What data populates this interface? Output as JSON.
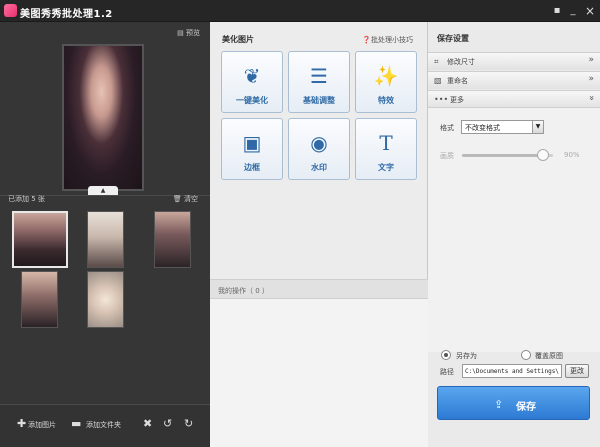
{
  "window": {
    "title": "美图秀秀批处理1.2",
    "minimize": "_",
    "close": "×",
    "menu": "▪"
  },
  "left": {
    "preview_label": "预览",
    "added_label": "已添加 5 张",
    "clear_label": "清空",
    "toolbar": {
      "add_image": "添加图片",
      "add_folder": "添加文件夹"
    }
  },
  "middle": {
    "section_title": "美化图片",
    "tips_label": "批处理小技巧",
    "tools": [
      {
        "label": "一键美化",
        "icon": "tulip-icon"
      },
      {
        "label": "基础调整",
        "icon": "sliders-icon"
      },
      {
        "label": "特效",
        "icon": "magic-wand-icon"
      },
      {
        "label": "边框",
        "icon": "frame-icon"
      },
      {
        "label": "水印",
        "icon": "watermark-icon"
      },
      {
        "label": "文字",
        "icon": "text-icon"
      }
    ],
    "ops_label": "我的操作（ 0 ）"
  },
  "right": {
    "section_title": "保存设置",
    "accordion": [
      {
        "label": "修改尺寸",
        "icon": "crop-icon"
      },
      {
        "label": "重命名",
        "icon": "rename-icon"
      },
      {
        "label": "更多",
        "icon": "more-icon"
      }
    ],
    "format_label": "格式",
    "format_value": "不改变格式",
    "quality_label": "画质",
    "quality_value": "90%",
    "quality_fraction": 0.9,
    "save_as_label": "另存为",
    "overwrite_label": "覆盖原图",
    "path_label": "路径",
    "path_value": "C:\\Documents and Settings\\",
    "change_label": "更改",
    "save_label": "保存"
  }
}
